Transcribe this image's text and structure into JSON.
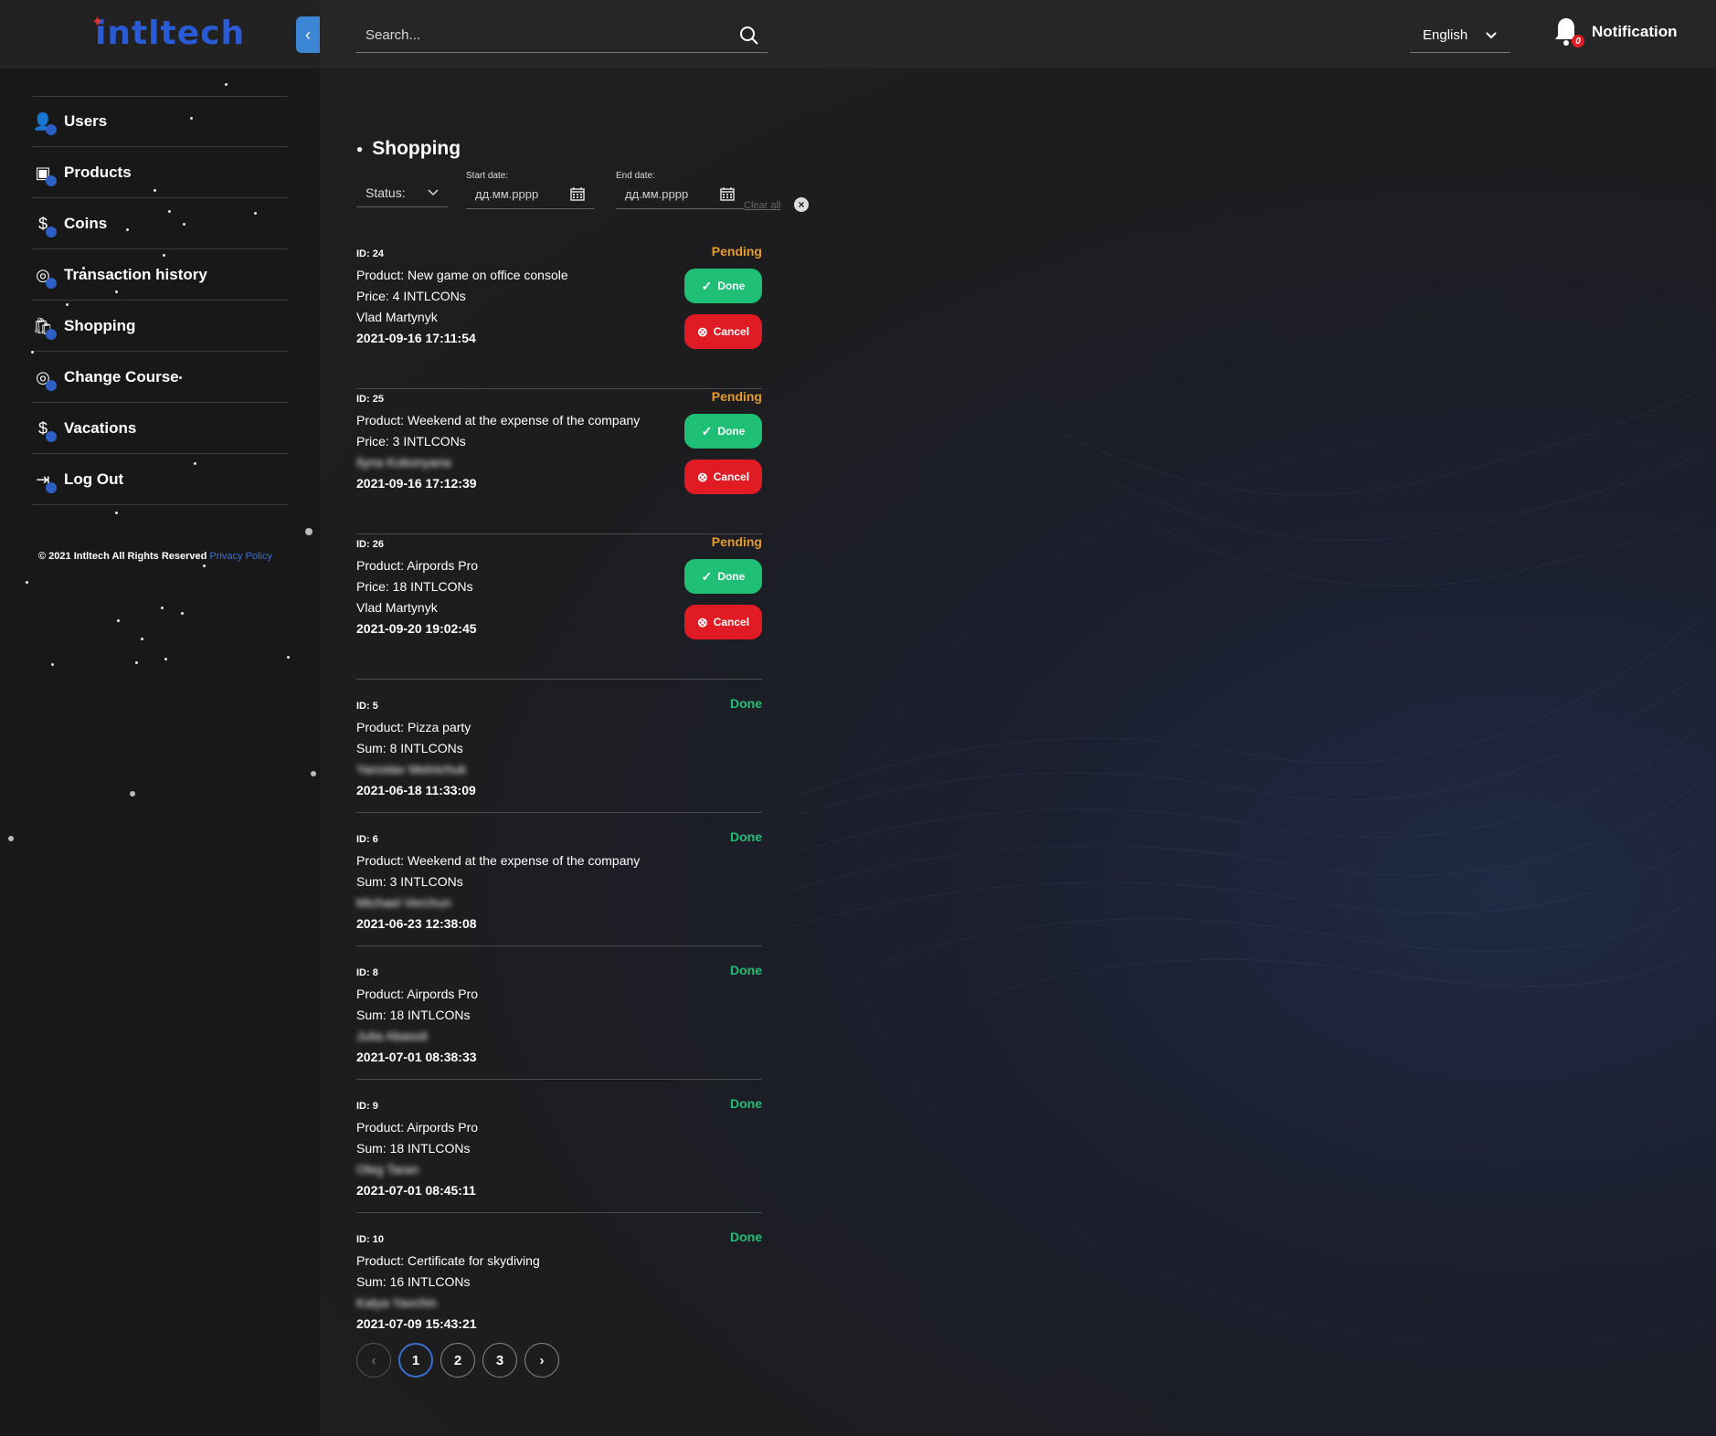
{
  "brand": {
    "logo_text": "intltech",
    "accent": "#2a5bd7"
  },
  "sidebar": {
    "items": [
      {
        "label": "Users",
        "icon": "user-icon"
      },
      {
        "label": "Products",
        "icon": "box-icon"
      },
      {
        "label": "Coins",
        "icon": "coin-icon"
      },
      {
        "label": "Transaction history",
        "icon": "history-icon"
      },
      {
        "label": "Shopping",
        "icon": "bag-icon"
      },
      {
        "label": "Change Course",
        "icon": "exchange-icon"
      },
      {
        "label": "Vacations",
        "icon": "vacation-icon"
      },
      {
        "label": "Log Out",
        "icon": "logout-icon"
      }
    ],
    "copyright": "© 2021 Intltech All Rights Reserved",
    "privacy": "Privacy Policy"
  },
  "topbar": {
    "search_placeholder": "Search...",
    "language": "English",
    "notification_label": "Notification",
    "notification_count": "0"
  },
  "page": {
    "title": "Shopping",
    "filters": {
      "status_label": "Status:",
      "start_label": "Start date:",
      "start_placeholder": "дд.мм.рррр",
      "end_label": "End date:",
      "end_placeholder": "дд.мм.рррр",
      "clear_label": "Clear all"
    },
    "done_btn": "Done",
    "cancel_btn": "Cancel",
    "orders": [
      {
        "id": "ID: 24",
        "product": "Product: New game on office console",
        "price": "Price: 4 INTLCONs",
        "user": "Vlad Martynyk",
        "date": "2021-09-16 17:11:54",
        "status": "Pending"
      },
      {
        "id": "ID: 25",
        "product": "Product: Weekend at the expense of the company",
        "price": "Price: 3 INTLCONs",
        "user": "Ilyna Kokonyana",
        "date": "2021-09-16 17:12:39",
        "status": "Pending"
      },
      {
        "id": "ID: 26",
        "product": "Product: Airpords Pro",
        "price": "Price: 18 INTLCONs",
        "user": "Vlad Martynyk",
        "date": "2021-09-20 19:02:45",
        "status": "Pending"
      },
      {
        "id": "ID: 5",
        "product": "Product: Pizza party",
        "price": "Sum: 8 INTLCONs",
        "user": "Yaroslav Melnichuk",
        "date": "2021-06-18 11:33:09",
        "status": "Done"
      },
      {
        "id": "ID: 6",
        "product": "Product: Weekend at the expense of the company",
        "price": "Sum: 3 INTLCONs",
        "user": "Michael Verchun",
        "date": "2021-06-23 12:38:08",
        "status": "Done"
      },
      {
        "id": "ID: 8",
        "product": "Product: Airpords Pro",
        "price": "Sum: 18 INTLCONs",
        "user": "Julia Abasoli",
        "date": "2021-07-01 08:38:33",
        "status": "Done"
      },
      {
        "id": "ID: 9",
        "product": "Product: Airpords Pro",
        "price": "Sum: 18 INTLCONs",
        "user": "Oleg Taran",
        "date": "2021-07-01 08:45:11",
        "status": "Done"
      },
      {
        "id": "ID: 10",
        "product": "Product: Certificate for skydiving",
        "price": "Sum: 16 INTLCONs",
        "user": "Katya Yavchin",
        "date": "2021-07-09 15:43:21",
        "status": "Done"
      }
    ],
    "pagination": {
      "prev": "‹",
      "pages": [
        "1",
        "2",
        "3"
      ],
      "next": "›",
      "current": "1"
    }
  },
  "colors": {
    "pending": "#e69b2a",
    "done": "#1fbf75",
    "cancel": "#e01b24"
  }
}
